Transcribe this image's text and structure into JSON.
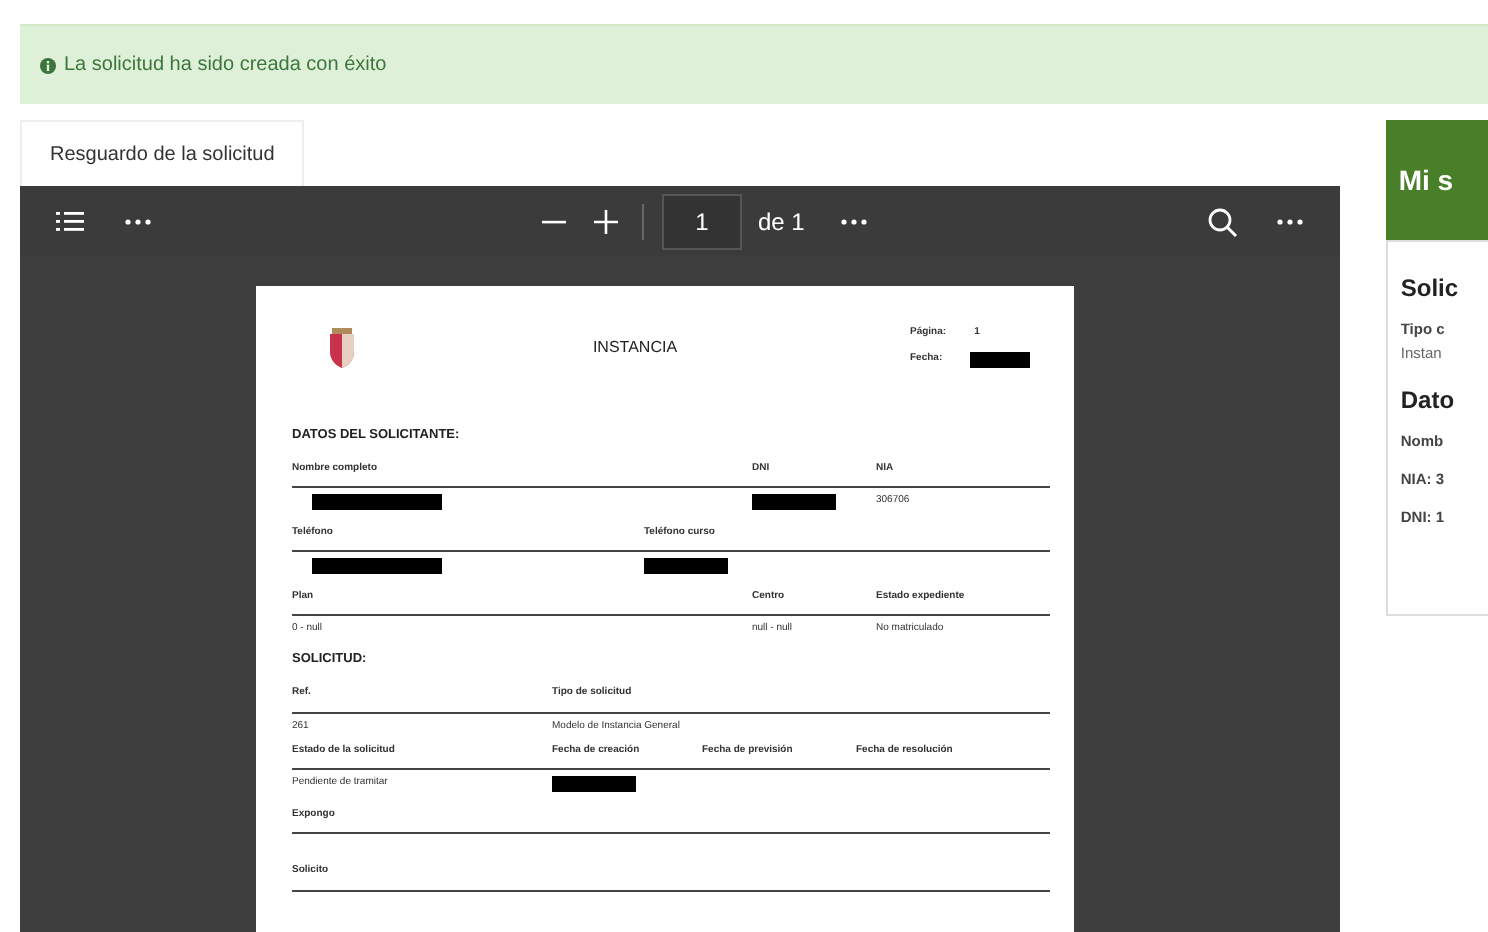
{
  "alert": {
    "text": "La solicitud ha sido creada con éxito"
  },
  "tabs": [
    {
      "label": "Resguardo de la solicitud",
      "selected": true
    }
  ],
  "viewer": {
    "page_input": "1",
    "page_total": "de 1",
    "document": {
      "title": "INSTANCIA",
      "meta": [
        {
          "label": "Página:",
          "value": "1"
        },
        {
          "label": "Fecha:",
          "redacted": true
        }
      ],
      "sections": [
        {
          "heading": "DATOS DEL SOLICITANTE:",
          "rows": [
            [
              {
                "label": "Nombre completo",
                "redacted": true
              },
              {
                "label": "DNI",
                "redacted": true
              },
              {
                "label": "NIA",
                "value": "306706"
              }
            ],
            [
              {
                "label": "Teléfono",
                "redacted": true
              },
              {
                "label": "Teléfono curso",
                "redacted": true
              }
            ],
            [
              {
                "label": "Plan",
                "value": "0 - null"
              },
              {
                "label": "Centro",
                "value": "null - null"
              },
              {
                "label": "Estado expediente",
                "value": "No matriculado"
              }
            ]
          ]
        },
        {
          "heading": "SOLICITUD:",
          "rows": [
            [
              {
                "label": "Ref.",
                "value": "261"
              },
              {
                "label": "Tipo de solicitud",
                "value": "Modelo de Instancia General"
              }
            ],
            [
              {
                "label": "Estado de la solicitud",
                "value": "Pendiente de tramitar"
              },
              {
                "label": "Fecha de creación",
                "redacted": true
              },
              {
                "label": "Fecha de previsión"
              },
              {
                "label": "Fecha de resolución"
              }
            ],
            [
              {
                "label": "Expongo"
              }
            ],
            [
              {
                "label": "Solicito"
              }
            ]
          ]
        }
      ]
    }
  },
  "side_panel": {
    "title": "Mi s",
    "items": [
      {
        "kind": "heading",
        "text": "Solic"
      },
      {
        "kind": "label",
        "text": "Tipo c"
      },
      {
        "kind": "value",
        "text": "Instan"
      },
      {
        "kind": "heading",
        "text": "Dato"
      },
      {
        "kind": "label",
        "text": "Nomb"
      },
      {
        "kind": "label",
        "text": "NIA: 3"
      },
      {
        "kind": "label",
        "text": "DNI: 1"
      }
    ]
  }
}
